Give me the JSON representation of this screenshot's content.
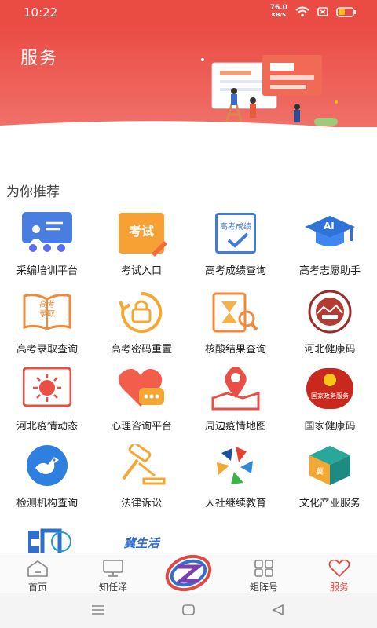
{
  "status": {
    "time": "10:22",
    "net_speed": "76.0",
    "net_unit": "KB/S"
  },
  "header": {
    "title": "服务"
  },
  "section": {
    "title": "为你推荐"
  },
  "services": [
    {
      "label": "采编培训平台",
      "icon": "training-icon"
    },
    {
      "label": "考试入口",
      "icon": "exam-icon",
      "icon_text": "考试"
    },
    {
      "label": "高考成绩查询",
      "icon": "score-query-icon",
      "icon_text": "高考成绩"
    },
    {
      "label": "高考志愿助手",
      "icon": "ai-graduation-icon",
      "icon_text": "AI"
    },
    {
      "label": "高考录取查询",
      "icon": "admission-book-icon",
      "icon_text": "高考 录取"
    },
    {
      "label": "高考密码重置",
      "icon": "password-reset-icon"
    },
    {
      "label": "核酸结果查询",
      "icon": "nucleic-test-icon"
    },
    {
      "label": "河北健康码",
      "icon": "hebei-health-code-icon"
    },
    {
      "label": "河北疫情动态",
      "icon": "virus-icon"
    },
    {
      "label": "心理咨询平台",
      "icon": "heart-chat-icon"
    },
    {
      "label": "周边疫情地图",
      "icon": "map-pin-icon"
    },
    {
      "label": "国家健康码",
      "icon": "national-health-code-icon",
      "icon_text": "国家政务服务"
    },
    {
      "label": "检测机构查询",
      "icon": "bird-icon"
    },
    {
      "label": "法律诉讼",
      "icon": "gavel-icon"
    },
    {
      "label": "人社继续教育",
      "icon": "pinwheel-icon"
    },
    {
      "label": "文化产业服务",
      "icon": "culture-box-icon"
    },
    {
      "label": "",
      "icon": "partial-logo-icon"
    },
    {
      "label": "",
      "icon": "ji-life-icon",
      "icon_text": "冀生活"
    }
  ],
  "tabs": [
    {
      "label": "首页",
      "icon": "home-icon"
    },
    {
      "label": "知任泽",
      "icon": "monitor-icon"
    },
    {
      "label": "矩阵号",
      "icon": "grid-icon"
    },
    {
      "label": "服务",
      "icon": "heart-icon"
    }
  ],
  "colors": {
    "brand": "#ea4c44",
    "active_tab": "#e24a40"
  }
}
